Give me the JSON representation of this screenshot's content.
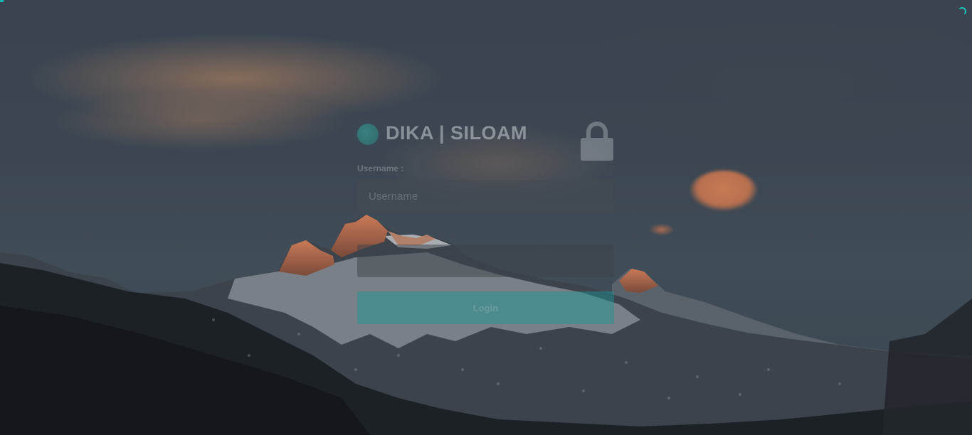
{
  "brand": {
    "title": "DIKA | SILOAM",
    "logo_icon": "teal-circle-logo",
    "accent_color": "#1cc0b8"
  },
  "lock": {
    "icon": "lock-icon"
  },
  "form": {
    "username_label": "Username :",
    "username_placeholder": "Username",
    "password_placeholder": "",
    "login_label": "Login"
  },
  "status": {
    "loading_icon": "spinner-icon"
  }
}
